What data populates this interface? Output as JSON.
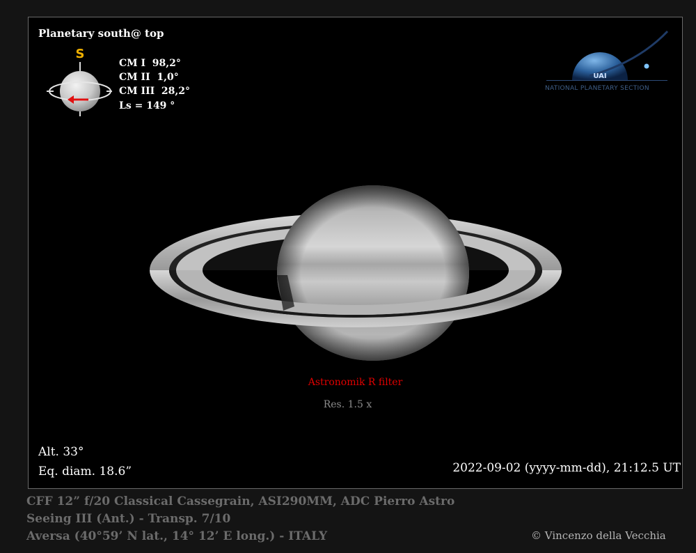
{
  "orientation": {
    "title": "Planetary south@ top",
    "pole_marker": "S",
    "cm1": "CM I  98,2°",
    "cm2": "CM II  1,0°",
    "cm3": "CM III  28,2°",
    "ls": "Ls = 149 °"
  },
  "logo": {
    "acronym": "UAI",
    "text": "NATIONAL PLANETARY SECTION"
  },
  "filter_label": "Astronomik R filter",
  "resolution": "Res. 1.5 x",
  "altitude": "Alt. 33°",
  "eq_diameter": "Eq. diam. 18.6”",
  "datetime": "2022-09-02 (yyyy-mm-dd), 21:12.5 UT",
  "footer": {
    "line1": "CFF 12” f/20 Classical Cassegrain, ASI290MM, ADC Pierro Astro",
    "line2": "Seeing III (Ant.) - Transp. 7/10",
    "line3": "Aversa (40°59’ N lat., 14° 12’ E long.) - ITALY"
  },
  "credit": "© Vincenzo della Vecchia",
  "colors": {
    "filter_text": "#e00000",
    "pole_marker": "#f0b000",
    "rotation_arrow": "#e01010"
  }
}
